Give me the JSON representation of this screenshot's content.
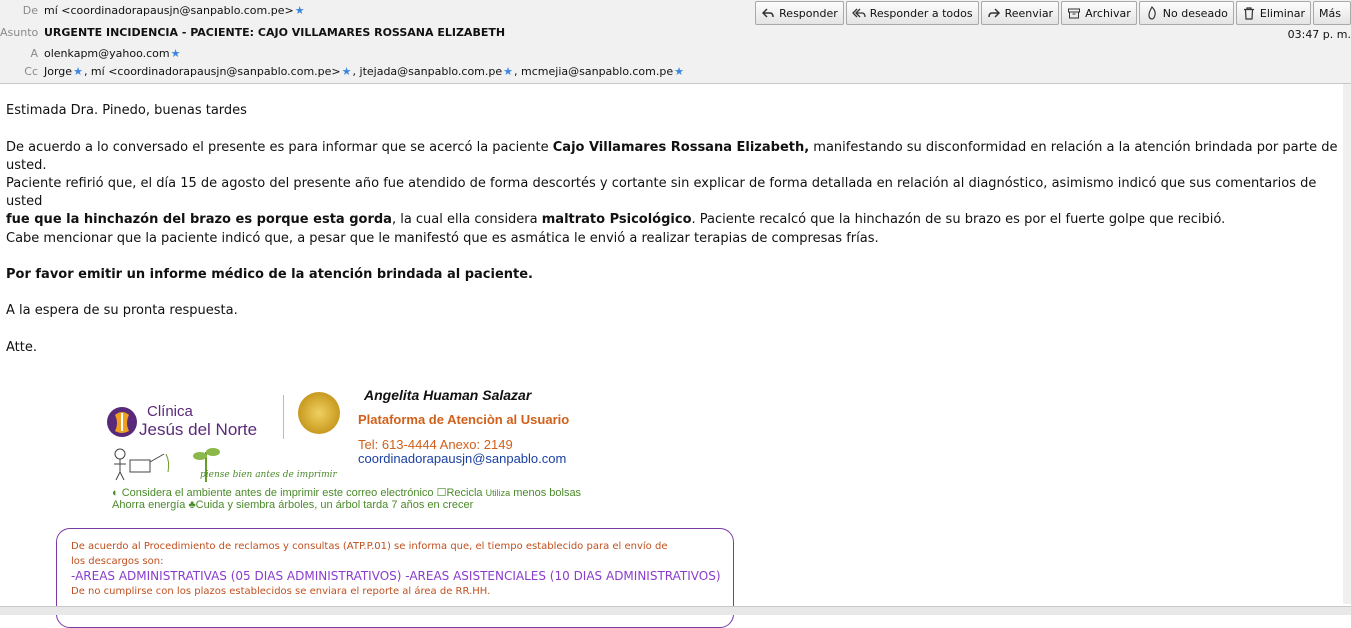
{
  "header": {
    "from_label": "De",
    "from_value": "mí <coordinadorapausjn@sanpablo.com.pe>",
    "subject_label": "Asunto",
    "subject_value": "URGENTE INCIDENCIA - PACIENTE: CAJO VILLAMARES ROSSANA ELIZABETH",
    "to_label": "A",
    "to_value": "olenkapm@yahoo.com",
    "cc_label": "Cc",
    "cc_values": [
      "Jorge",
      ", mí <coordinadorapausjn@sanpablo.com.pe>",
      ", jtejada@sanpablo.com.pe",
      ", mcmejia@sanpablo.com.pe"
    ],
    "time": "03:47 p. m."
  },
  "toolbar": {
    "reply": "Responder",
    "reply_all": "Responder a todos",
    "forward": "Reenviar",
    "archive": "Archivar",
    "junk": "No deseado",
    "delete": "Eliminar",
    "more": "Más"
  },
  "message": {
    "greeting": "Estimada Dra. Pinedo, buenas tardes",
    "p1_a": "De acuerdo a lo conversado el presente es para informar que se acercó la paciente ",
    "p1_b": "Cajo Villamares Rossana Elizabeth,",
    "p1_c": " manifestando su disconformidad en relación a la atención brindada por parte de usted.",
    "p2_a": "Paciente refirió que, el día 15 de agosto del presente año fue atendido de forma descortés y cortante sin explicar de forma detallada en relación al diagnóstico, asimismo indicó que sus comentarios de usted",
    "p2_b": "fue que la hinchazón del brazo es porque esta gorda",
    "p2_c": ", la cual ella considera ",
    "p2_d": "maltrato Psicológico",
    "p2_e": ". Paciente recalcó que la hinchazón de su brazo es por el fuerte golpe que recibió.",
    "p3": "Cabe mencionar que la paciente indicó que, a pesar que le manifestó que es asmática le envió a realizar terapias de compresas frías.",
    "p4": "Por favor emitir un informe médico de la atención brindada al paciente.",
    "p5": "A la espera de su pronta respuesta.",
    "p6": "Atte."
  },
  "signature": {
    "logo_line1": "Clínica",
    "logo_line2": "Jesús del Norte",
    "name": "Angelita Huaman Salazar",
    "department": "Plataforma de Atenciòn al Usuario",
    "phone": "Tel: 613-4444   Anexo: 2149",
    "email": "coordinadorapausjn@sanpablo.com",
    "eco_handwriting": "piense bien antes de imprimir",
    "eco_line1": "Considera el ambiente antes de imprimir este correo electrónico",
    "eco_recicla": "Recicla",
    "eco_utiliza": "Utiliza",
    "eco_menos": "menos bolsas",
    "eco_line2": "Ahorra energía",
    "eco_line2b": "Cuida y siembra árboles, un árbol tarda 7 años en crecer"
  },
  "notice": {
    "line1": "De acuerdo al Procedimiento de reclamos y consultas (ATP.P.01) se informa que, el tiempo establecido para el envío de",
    "line2": "los descargos son:",
    "line3": "-AREAS ADMINISTRATIVAS (05 DIAS ADMINISTRATIVOS)  -AREAS ASISTENCIALES (10 DIAS ADMINISTRATIVOS)",
    "line4": "De no cumplirse con los plazos establecidos se enviara el reporte al área de RR.HH."
  },
  "colors": {
    "accent_purple": "#8a3ccc",
    "notice_orange": "#c0501f",
    "link_blue": "#1a3fa0"
  }
}
